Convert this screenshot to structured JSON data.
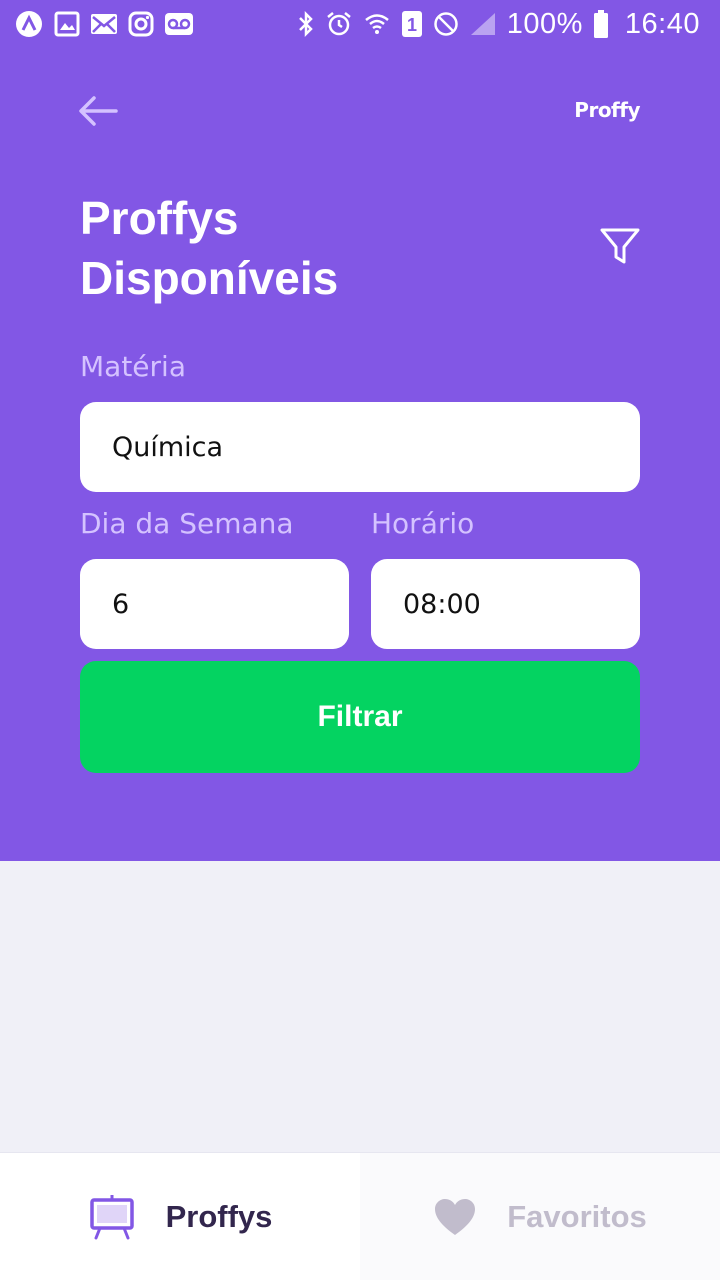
{
  "colors": {
    "primary": "#8257e5",
    "success": "#04d361",
    "background": "#f0f0f7",
    "label": "#d4c2ff",
    "tab_active_text": "#32264d",
    "tab_inactive_text": "#c1bccc"
  },
  "status_bar": {
    "left_icons": [
      "app-icon",
      "image-icon",
      "mail-icon",
      "instagram-icon",
      "voicemail-icon"
    ],
    "right_icons": [
      "bluetooth-icon",
      "alarm-icon",
      "wifi-icon",
      "sim-icon",
      "do-not-disturb-icon",
      "signal-icon",
      "battery-icon"
    ],
    "sim_slot": "1",
    "battery_text": "100%",
    "time": "16:40"
  },
  "header": {
    "brand": "Proffy",
    "title_line1": "Proffys",
    "title_line2": "Disponíveis",
    "back_icon": "arrow-left-icon",
    "filter_icon": "filter-icon"
  },
  "form": {
    "subject_label": "Matéria",
    "subject_value": "Química",
    "weekday_label": "Dia da Semana",
    "weekday_value": "6",
    "time_label": "Horário",
    "time_value": "08:00",
    "submit_label": "Filtrar"
  },
  "tabs": [
    {
      "label": "Proffys",
      "icon": "easel-icon",
      "active": true
    },
    {
      "label": "Favoritos",
      "icon": "heart-icon",
      "active": false
    }
  ]
}
